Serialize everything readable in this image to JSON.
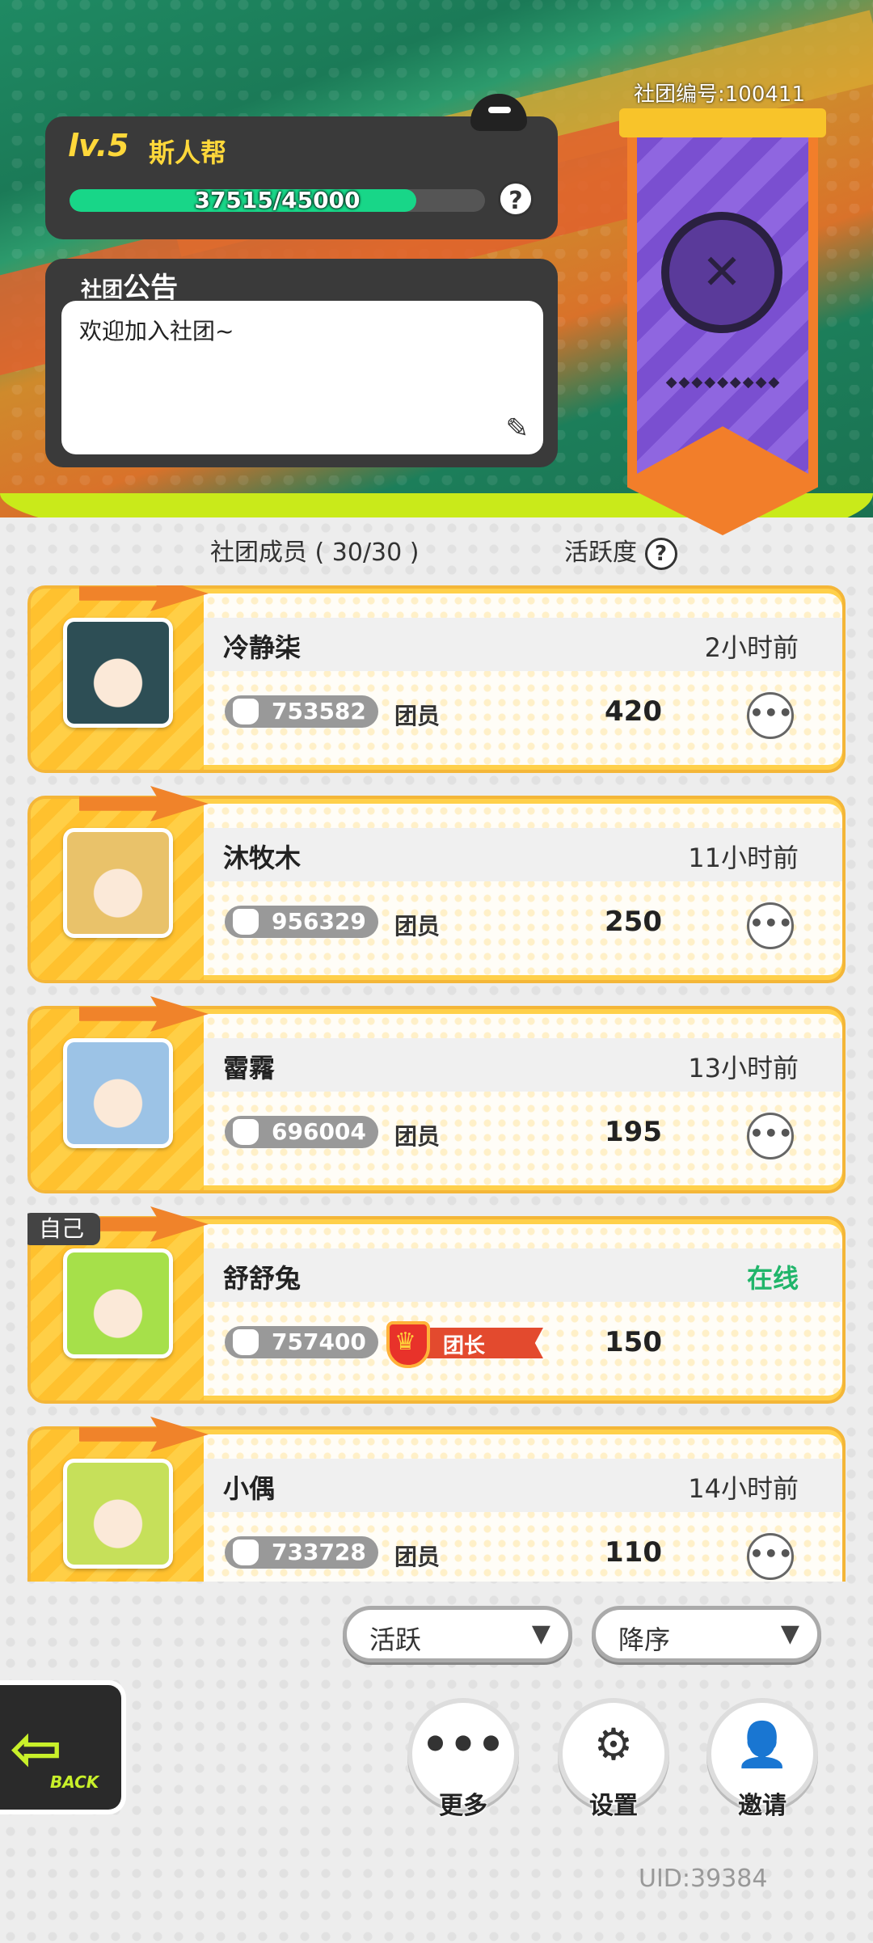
{
  "club": {
    "level": "lv.5",
    "name": "斯人帮",
    "xp_text": "37515/45000",
    "xp_progress": 0.8337,
    "id_label": "社团编号:100411"
  },
  "announcement": {
    "title_small": "社团",
    "title_big": "公告",
    "body": "欢迎加入社团~"
  },
  "members_header": {
    "members_label": "社团成员 ( 30/30 )",
    "activity_label": "活跃度"
  },
  "members": [
    {
      "name": "冷静柒",
      "time": "2小时前",
      "power": "753582",
      "role": "团员",
      "activity": "420",
      "online": false,
      "self": false,
      "avatar_color": "#2d4e55"
    },
    {
      "name": "沐牧木",
      "time": "11小时前",
      "power": "956329",
      "role": "团员",
      "activity": "250",
      "online": false,
      "self": false,
      "avatar_color": "#e9c26a"
    },
    {
      "name": "霤霿",
      "time": "13小时前",
      "power": "696004",
      "role": "团员",
      "activity": "195",
      "online": false,
      "self": false,
      "avatar_color": "#9cc3e6"
    },
    {
      "name": "舒舒兔",
      "time": "在线",
      "power": "757400",
      "role": "团长",
      "activity": "150",
      "online": true,
      "self": true,
      "self_tag": "自己",
      "avatar_color": "#a6e04a"
    },
    {
      "name": "小偶",
      "time": "14小时前",
      "power": "733728",
      "role": "团员",
      "activity": "110",
      "online": false,
      "self": false,
      "avatar_color": "#c6e05a"
    }
  ],
  "sort": {
    "field": "活跃",
    "order": "降序"
  },
  "actions": {
    "more": "更多",
    "settings": "设置",
    "invite": "邀请"
  },
  "back_label": "BACK",
  "uid": "UID:39384",
  "colors": {
    "accent_yellow": "#ffd04a",
    "online_green": "#20b56a",
    "xp_green": "#18d688",
    "leader_red": "#e34a2e"
  }
}
